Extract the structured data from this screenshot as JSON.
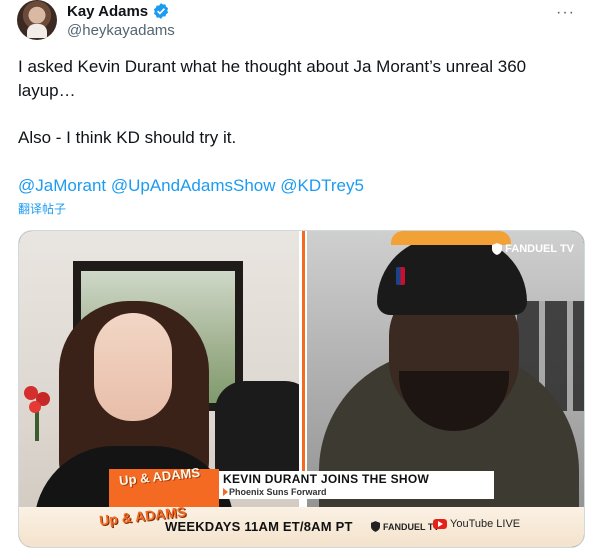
{
  "author": {
    "display_name": "Kay Adams",
    "handle": "@heykayadams",
    "verified_icon": "verified-badge-icon",
    "avatar_icon": "avatar"
  },
  "more_label": "···",
  "tweet": {
    "paragraph1": "I asked Kevin Durant what he thought about Ja Morant’s unreal 360 layup…",
    "paragraph2": "Also - I think KD should try it.",
    "mentions": [
      "@JaMorant",
      "@UpAndAdamsShow",
      "@KDTrey5"
    ],
    "translate_label": "翻译帖子"
  },
  "video": {
    "fanduel_top": "FANDUEL TV",
    "show_logo": "Up & ADAMS",
    "lower_third_title": "KEVIN DURANT JOINS THE SHOW",
    "lower_third_subtitle": "Phoenix Suns Forward",
    "bottom_logo": "Up & ADAMS",
    "schedule": "WEEKDAYS 11AM ET/8AM PT",
    "bottom_fanduel": "FANDUEL TV",
    "youtube_live": "YouTube LIVE",
    "colors": {
      "accent": "#f46a23",
      "link": "#1d9bf0"
    }
  }
}
